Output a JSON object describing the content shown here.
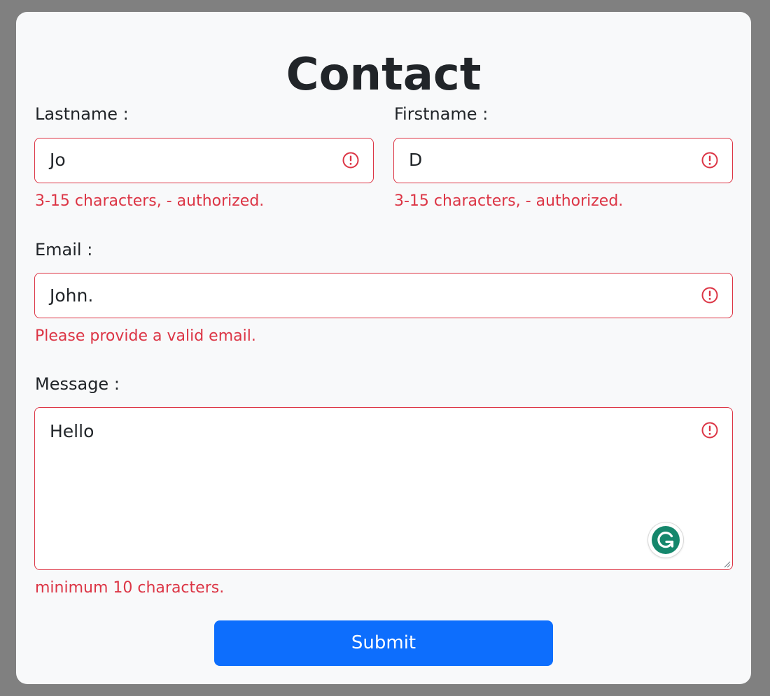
{
  "form": {
    "title": "Contact",
    "lastname": {
      "label": "Lastname :",
      "value": "Jo",
      "error": "3-15 characters, - authorized."
    },
    "firstname": {
      "label": "Firstname :",
      "value": "D",
      "error": "3-15 characters, - authorized."
    },
    "email": {
      "label": "Email :",
      "value": "John.",
      "error": "Please provide a valid email."
    },
    "message": {
      "label": "Message :",
      "value": "Hello",
      "error": "minimum 10 characters."
    },
    "submit_label": "Submit"
  },
  "colors": {
    "backdrop": "#808080",
    "card": "#f8f9fa",
    "error": "#dc3545",
    "primary": "#0d6efd",
    "text": "#212529",
    "grammarly": "#15876c"
  },
  "icons": {
    "field_state": "exclamation-circle-icon",
    "extension": "grammarly-icon"
  }
}
